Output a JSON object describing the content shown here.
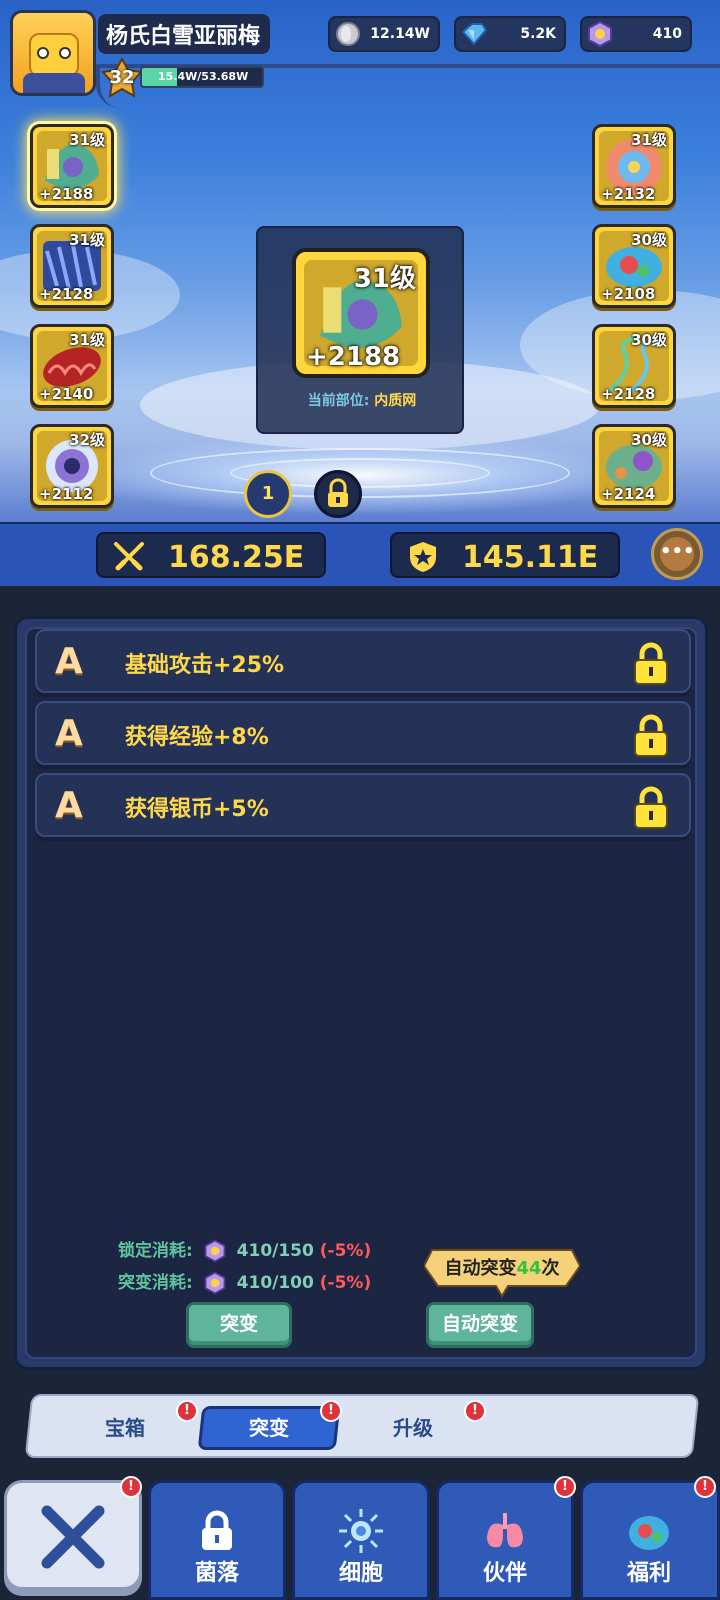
{
  "player": {
    "name": "杨氏白雪亚丽梅",
    "level": "32",
    "exp_text": "15.4W/53.68W",
    "exp_fraction": 0.29
  },
  "currencies": [
    {
      "icon": "silver-coin-icon",
      "value": "12.14W"
    },
    {
      "icon": "diamond-icon",
      "value": "5.2K"
    },
    {
      "icon": "mutation-crystal-icon",
      "value": "410"
    }
  ],
  "slots_left": [
    {
      "level": "31级",
      "power": "+2188",
      "icon": "endoplasmic-reticulum-icon",
      "selected": true
    },
    {
      "level": "31级",
      "power": "+2128",
      "icon": "membrane-cluster-icon",
      "selected": false
    },
    {
      "level": "31级",
      "power": "+2140",
      "icon": "mitochondria-icon",
      "selected": false
    },
    {
      "level": "32级",
      "power": "+2112",
      "icon": "nucleus-icon",
      "selected": false
    }
  ],
  "slots_right": [
    {
      "level": "31级",
      "power": "+2132",
      "icon": "golgi-icon"
    },
    {
      "level": "30级",
      "power": "+2108",
      "icon": "chloroplast-icon"
    },
    {
      "level": "30级",
      "power": "+2128",
      "icon": "dna-helix-icon"
    },
    {
      "level": "30级",
      "power": "+2124",
      "icon": "cell-icon"
    }
  ],
  "center": {
    "level": "31级",
    "power": "+2188",
    "part_label": "当前部位:",
    "part_value": "内质网"
  },
  "pager": {
    "page": "1"
  },
  "stats": {
    "attack": "168.25E",
    "defense": "145.11E",
    "more": "•••"
  },
  "attributes": [
    {
      "grade": "A",
      "text": "基础攻击+25%"
    },
    {
      "grade": "A",
      "text": "获得经验+8%"
    },
    {
      "grade": "A",
      "text": "获得银币+5%"
    }
  ],
  "costs": {
    "lock_label": "锁定消耗:",
    "lock_value": "410/150",
    "lock_discount": "(-5%)",
    "mutate_label": "突变消耗:",
    "mutate_value": "410/100",
    "mutate_discount": "(-5%)"
  },
  "auto_tip": {
    "prefix": "自动突变",
    "count": "44",
    "suffix": "次"
  },
  "buttons": {
    "mutate": "突变",
    "auto_mutate": "自动突变"
  },
  "tabs": [
    {
      "label": "宝箱",
      "badge": "!"
    },
    {
      "label": "突变",
      "badge": "!",
      "active": true
    },
    {
      "label": "升级",
      "badge": "!"
    }
  ],
  "bottom_nav": [
    {
      "label": "菌落",
      "icon": "lock-icon",
      "badge": ""
    },
    {
      "label": "细胞",
      "icon": "cell-burst-icon",
      "badge": ""
    },
    {
      "label": "伙伴",
      "icon": "lungs-icon",
      "badge": "!"
    },
    {
      "label": "福利",
      "icon": "chloroplast-gift-icon",
      "badge": "!"
    }
  ],
  "close_badge": "!",
  "colors": {
    "gold": "#ffd84a",
    "accent_blue": "#2f64d2",
    "green_button": "#5fb59b",
    "badge_red": "#e0323a"
  }
}
